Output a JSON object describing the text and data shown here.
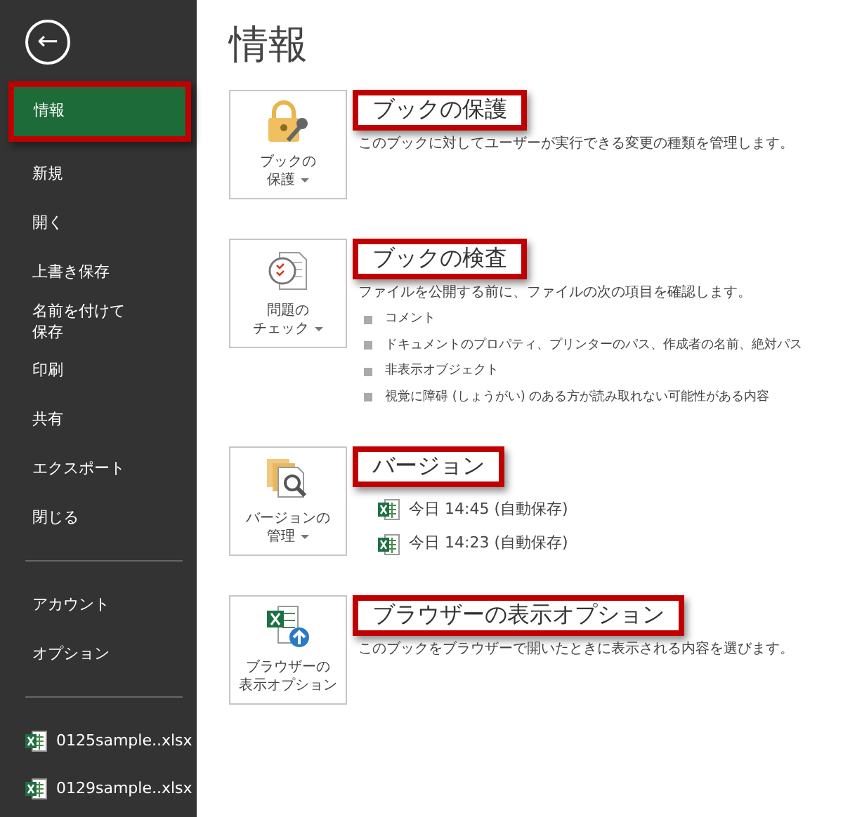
{
  "nav": {
    "back": "←",
    "items": [
      {
        "label": "情報",
        "selected": true,
        "highlighted": true
      },
      {
        "label": "新規",
        "selected": false,
        "highlighted": false
      },
      {
        "label": "開く",
        "selected": false,
        "highlighted": false
      },
      {
        "label": "上書き保存",
        "selected": false,
        "highlighted": false
      },
      {
        "label": [
          "名前を付けて",
          "保存"
        ],
        "selected": false,
        "highlighted": false
      },
      {
        "label": "印刷",
        "selected": false,
        "highlighted": false
      },
      {
        "label": "共有",
        "selected": false,
        "highlighted": false
      },
      {
        "label": "エクスポート",
        "selected": false,
        "highlighted": false
      },
      {
        "label": "閉じる",
        "selected": false,
        "highlighted": false
      },
      {
        "kind": "divider"
      },
      {
        "label": "アカウント",
        "selected": false,
        "highlighted": false
      },
      {
        "label": "オプション",
        "selected": false,
        "highlighted": false
      },
      {
        "kind": "divider"
      },
      {
        "kind": "file",
        "label": "0125sample..xlsx"
      },
      {
        "kind": "file",
        "label": "0129sample..xlsx"
      }
    ]
  },
  "page_title": "情報",
  "sections": [
    {
      "kind": "protect",
      "button": [
        "ブックの",
        "保護"
      ],
      "dropdown": true,
      "title": "ブックの保護",
      "highlighted": true,
      "description": "このブックに対してユーザーが実行できる変更の種類を管理します。"
    },
    {
      "kind": "inspect",
      "button": [
        "問題の",
        "チェック"
      ],
      "dropdown": true,
      "title": "ブックの検査",
      "highlighted": true,
      "description": "ファイルを公開する前に、ファイルの次の項目を確認します。",
      "bullets": [
        "コメント",
        "ドキュメントのプロパティ、プリンターのパス、作成者の名前、絶対パス",
        "非表示オブジェクト",
        "視覚に障碍 (しょうがい) のある方が読み取れない可能性がある内容"
      ]
    },
    {
      "kind": "versions",
      "button": [
        "バージョンの",
        "管理"
      ],
      "dropdown": true,
      "title": "バージョン",
      "highlighted": true,
      "versions": [
        "今日 14:45 (自動保存)",
        "今日 14:23 (自動保存)"
      ]
    },
    {
      "kind": "browser",
      "button": [
        "ブラウザーの",
        "表示オプション"
      ],
      "dropdown": false,
      "title": "ブラウザーの表示オプション",
      "highlighted": true,
      "description": "このブックをブラウザーで開いたときに表示される内容を選びます。"
    }
  ]
}
